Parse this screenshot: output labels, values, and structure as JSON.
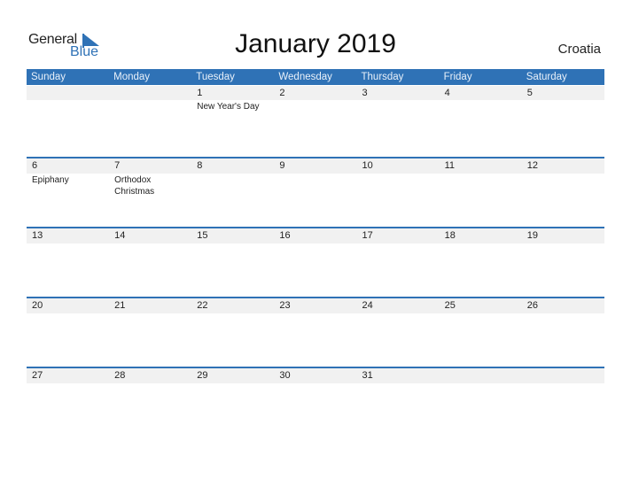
{
  "brand": {
    "line1": "General",
    "line2": "Blue",
    "accent": "#2f72b6"
  },
  "title": "January 2019",
  "country": "Croatia",
  "days_of_week": [
    "Sunday",
    "Monday",
    "Tuesday",
    "Wednesday",
    "Thursday",
    "Friday",
    "Saturday"
  ],
  "weeks": [
    [
      {
        "day": "",
        "event": ""
      },
      {
        "day": "",
        "event": ""
      },
      {
        "day": "1",
        "event": "New Year's Day"
      },
      {
        "day": "2",
        "event": ""
      },
      {
        "day": "3",
        "event": ""
      },
      {
        "day": "4",
        "event": ""
      },
      {
        "day": "5",
        "event": ""
      }
    ],
    [
      {
        "day": "6",
        "event": "Epiphany"
      },
      {
        "day": "7",
        "event": "Orthodox Christmas"
      },
      {
        "day": "8",
        "event": ""
      },
      {
        "day": "9",
        "event": ""
      },
      {
        "day": "10",
        "event": ""
      },
      {
        "day": "11",
        "event": ""
      },
      {
        "day": "12",
        "event": ""
      }
    ],
    [
      {
        "day": "13",
        "event": ""
      },
      {
        "day": "14",
        "event": ""
      },
      {
        "day": "15",
        "event": ""
      },
      {
        "day": "16",
        "event": ""
      },
      {
        "day": "17",
        "event": ""
      },
      {
        "day": "18",
        "event": ""
      },
      {
        "day": "19",
        "event": ""
      }
    ],
    [
      {
        "day": "20",
        "event": ""
      },
      {
        "day": "21",
        "event": ""
      },
      {
        "day": "22",
        "event": ""
      },
      {
        "day": "23",
        "event": ""
      },
      {
        "day": "24",
        "event": ""
      },
      {
        "day": "25",
        "event": ""
      },
      {
        "day": "26",
        "event": ""
      }
    ],
    [
      {
        "day": "27",
        "event": ""
      },
      {
        "day": "28",
        "event": ""
      },
      {
        "day": "29",
        "event": ""
      },
      {
        "day": "30",
        "event": ""
      },
      {
        "day": "31",
        "event": ""
      },
      {
        "day": "",
        "event": ""
      },
      {
        "day": "",
        "event": ""
      }
    ]
  ]
}
